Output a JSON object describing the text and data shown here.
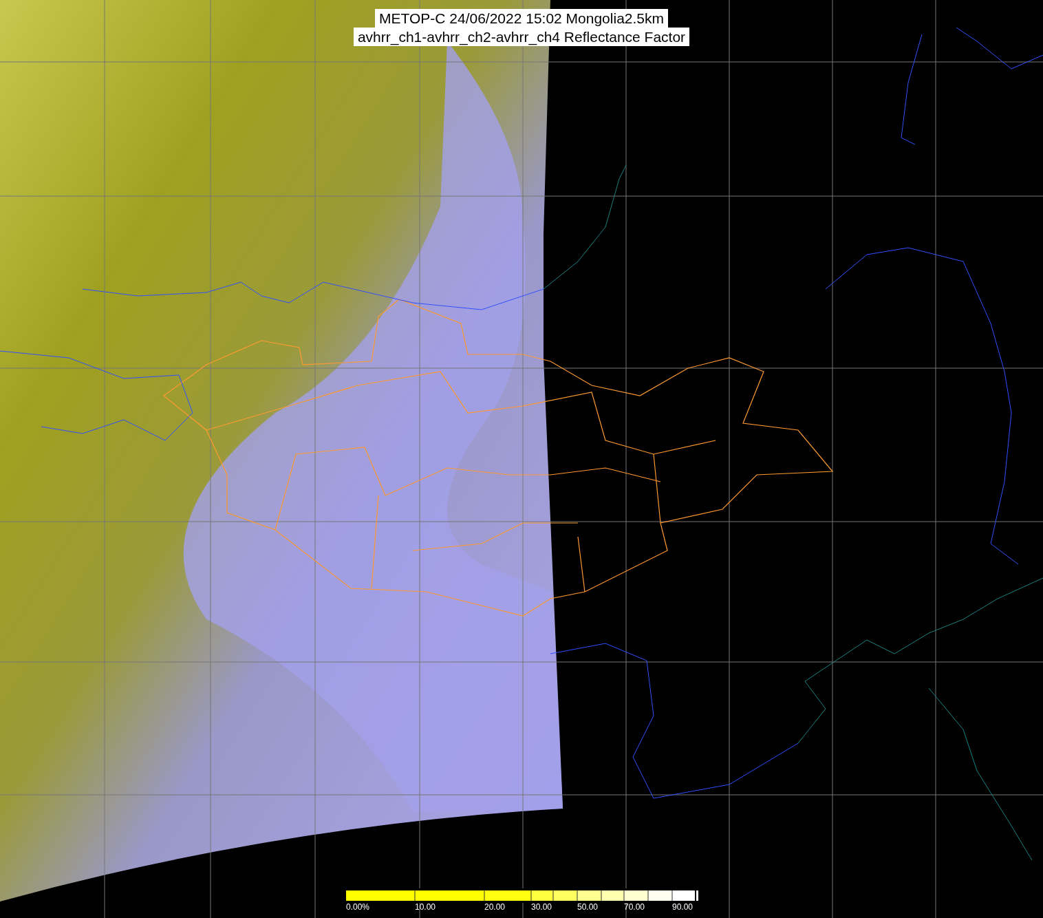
{
  "title": {
    "lines": [
      "METOP-C 24/06/2022 15:02 Mongolia2.5km",
      "avhrr_ch1-avhrr_ch2-avhrr_ch4 Reflectance Factor"
    ]
  },
  "legend": {
    "ticks": [
      "0.00%",
      "10.00",
      "20.00",
      "30.00",
      "50.00",
      "70.00",
      "90.00"
    ]
  }
}
